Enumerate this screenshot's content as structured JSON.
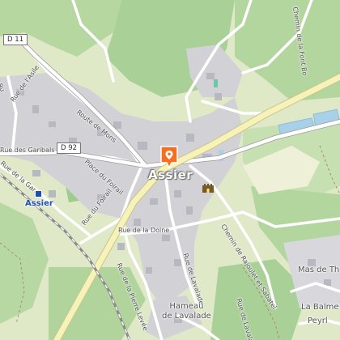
{
  "town": {
    "name": "Assier"
  },
  "shields": {
    "d11": "D 11",
    "d92": "D 92"
  },
  "station": {
    "name": "Assier"
  },
  "places": {
    "hameau_line1": "Hameau",
    "hameau_line2": "de Lavalade",
    "mas": "Mas de Th",
    "balme": "La Balme",
    "peyre": "Peyrl"
  },
  "roads": {
    "rue_asile": "Rue de l'Asile",
    "route_mons": "Route de Mons",
    "rue_gare": "Rue de la Gare",
    "rue_garibals": "Rue des Garibals",
    "place_foirail": "Place du Foirail",
    "rue_foirail": "Rue du Foirail",
    "rue_doine": "Rue de la Doine",
    "rue_pierre_levee": "Rue de la Pierre Levée",
    "rue_lavalade": "Rue de Lavalade",
    "chemin_rajoulet": "Chemin de Rajoulet et Sabatel",
    "chemin_font": "Chemin de la Font Bo",
    "rue_lavalade_2": "Rue de Lavalade",
    "rue_truncated": "Ru"
  },
  "colors": {
    "accent_marker": "#f36f24",
    "road_main": "#f6f2b8",
    "built_area": "#cbcbd0",
    "forest": "#afd39b",
    "water": "#a8d0e8"
  },
  "icons": {
    "poi_marker": "map-pin-icon",
    "castle": "castle-icon",
    "train_station": "train-station-icon"
  }
}
